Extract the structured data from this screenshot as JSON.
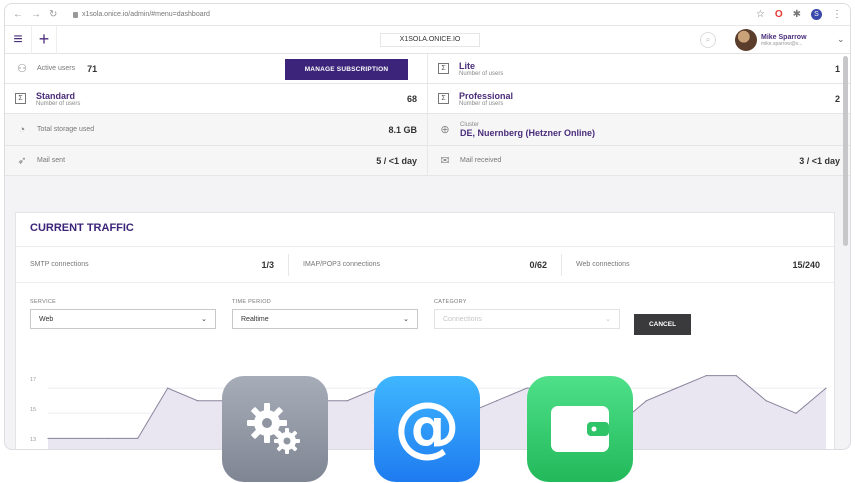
{
  "browser": {
    "url": "x1sola.onice.io/admin/#menu=dashboard",
    "ext_initial": "S"
  },
  "header": {
    "domain": "X1SOLA.ONICE.IO",
    "user_name": "Mike Sparrow",
    "user_email": "mike.sparrow@x..."
  },
  "stats": {
    "active_users_label": "Active users",
    "active_users_value": "71",
    "manage_label": "MANAGE SUBSCRIPTION",
    "lite_title": "Lite",
    "lite_sub": "Number of users",
    "lite_value": "1",
    "standard_title": "Standard",
    "standard_sub": "Number of users",
    "standard_value": "68",
    "professional_title": "Professional",
    "professional_sub": "Number of users",
    "professional_value": "2",
    "storage_label": "Total storage used",
    "storage_value": "8.1 GB",
    "cluster_label": "Cluster",
    "cluster_value": "DE, Nuernberg (Hetzner Online)",
    "mail_sent_label": "Mail sent",
    "mail_sent_value": "5 / <1 day",
    "mail_received_label": "Mail received",
    "mail_received_value": "3 / <1 day"
  },
  "traffic": {
    "title": "CURRENT TRAFFIC",
    "smtp_label": "SMTP connections",
    "smtp_value": "1/3",
    "imap_label": "IMAP/POP3 connections",
    "imap_value": "0/62",
    "web_label": "Web connections",
    "web_value": "15/240",
    "service_label": "SERVICE",
    "service_value": "Web",
    "period_label": "TIME PERIOD",
    "period_value": "Realtime",
    "category_label": "CATEGORY",
    "category_value": "Connections",
    "cancel_label": "CANCEL",
    "y_ticks": [
      "17",
      "15",
      "13"
    ]
  },
  "chart_data": {
    "type": "area",
    "y": [
      13,
      13,
      13,
      13,
      17,
      16,
      16,
      14,
      17,
      16,
      16,
      17,
      16,
      16,
      15,
      16,
      17,
      17,
      15,
      14,
      16,
      17,
      18,
      18,
      16,
      15,
      17
    ],
    "color": "#e9e6f2",
    "line_color": "#8a849c"
  },
  "colors": {
    "brand": "#3b2479",
    "dark_button": "#3a3a3d"
  },
  "dock": [
    "gears-icon",
    "at-sign-icon",
    "wallet-icon"
  ]
}
